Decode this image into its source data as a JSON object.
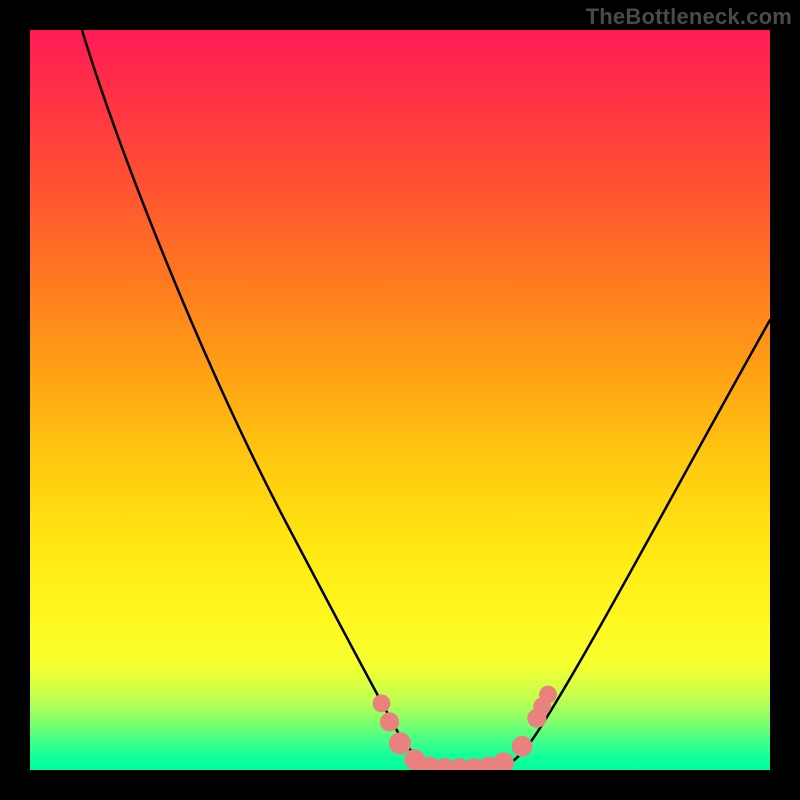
{
  "watermark": "TheBottleneck.com",
  "chart_data": {
    "type": "line",
    "title": "",
    "xlabel": "",
    "ylabel": "",
    "xlim": [
      0,
      100
    ],
    "ylim": [
      0,
      100
    ],
    "grid": false,
    "legend": false,
    "background_gradient": {
      "direction": "top-to-bottom",
      "stops": [
        {
          "pos": 0,
          "color": "#ff1a55"
        },
        {
          "pos": 50,
          "color": "#ffb015"
        },
        {
          "pos": 85,
          "color": "#f9ff28"
        },
        {
          "pos": 100,
          "color": "#00ff9e"
        }
      ]
    },
    "series": [
      {
        "name": "left-branch",
        "x": [
          7,
          12,
          20,
          28,
          36,
          44,
          50,
          53
        ],
        "y": [
          100,
          88,
          70,
          52,
          34,
          16,
          4,
          0
        ]
      },
      {
        "name": "right-branch",
        "x": [
          65,
          68,
          74,
          82,
          90,
          100
        ],
        "y": [
          0,
          4,
          14,
          30,
          46,
          62
        ]
      },
      {
        "name": "valley-floor",
        "x": [
          53,
          56,
          59,
          62,
          65
        ],
        "y": [
          0,
          0,
          0,
          0,
          0
        ]
      }
    ],
    "markers": [
      {
        "x": 47.5,
        "y": 9,
        "r": 1.2
      },
      {
        "x": 48.6,
        "y": 6.5,
        "r": 1.3
      },
      {
        "x": 50.0,
        "y": 3.6,
        "r": 1.5
      },
      {
        "x": 52.0,
        "y": 1.4,
        "r": 1.4
      },
      {
        "x": 54.0,
        "y": 0.4,
        "r": 1.4
      },
      {
        "x": 56.0,
        "y": 0.2,
        "r": 1.4
      },
      {
        "x": 58.0,
        "y": 0.2,
        "r": 1.4
      },
      {
        "x": 60.0,
        "y": 0.2,
        "r": 1.4
      },
      {
        "x": 62.0,
        "y": 0.4,
        "r": 1.4
      },
      {
        "x": 64.0,
        "y": 1.0,
        "r": 1.4
      },
      {
        "x": 66.5,
        "y": 3.2,
        "r": 1.4
      },
      {
        "x": 68.5,
        "y": 7.0,
        "r": 1.3
      },
      {
        "x": 69.2,
        "y": 8.6,
        "r": 1.2
      },
      {
        "x": 70.0,
        "y": 10.2,
        "r": 1.2
      }
    ],
    "frame_color": "#000000"
  }
}
